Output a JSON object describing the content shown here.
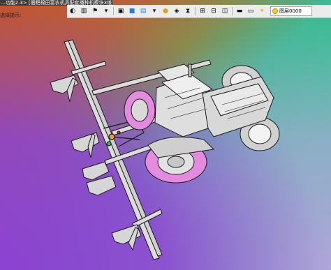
{
  "window": {
    "title": "...功能2.3> [捆粑棉田富农机具配套播种机模块3维]"
  },
  "toolbar": {
    "icons": [
      "color-wheel-icon",
      "align-icon",
      "flag-icon",
      "chevron-down-icon",
      "stamp-icon",
      "cube-icon",
      "shade-icon",
      "dropdown-icon",
      "sphere-icon",
      "selection-icon",
      "filter-icon",
      "link-icon",
      "section-icon",
      "view-icon",
      "display-icon",
      "chevron-icon",
      "line-weight-icon",
      "fill-icon",
      "bulb-icon",
      "sun-icon"
    ],
    "layer_label": "图层0000"
  },
  "command_prompt": "选择提示:",
  "colors": {
    "accent": "#e48be0",
    "model_body": "#dcdcdc",
    "model_edge": "#1a1a1a"
  }
}
